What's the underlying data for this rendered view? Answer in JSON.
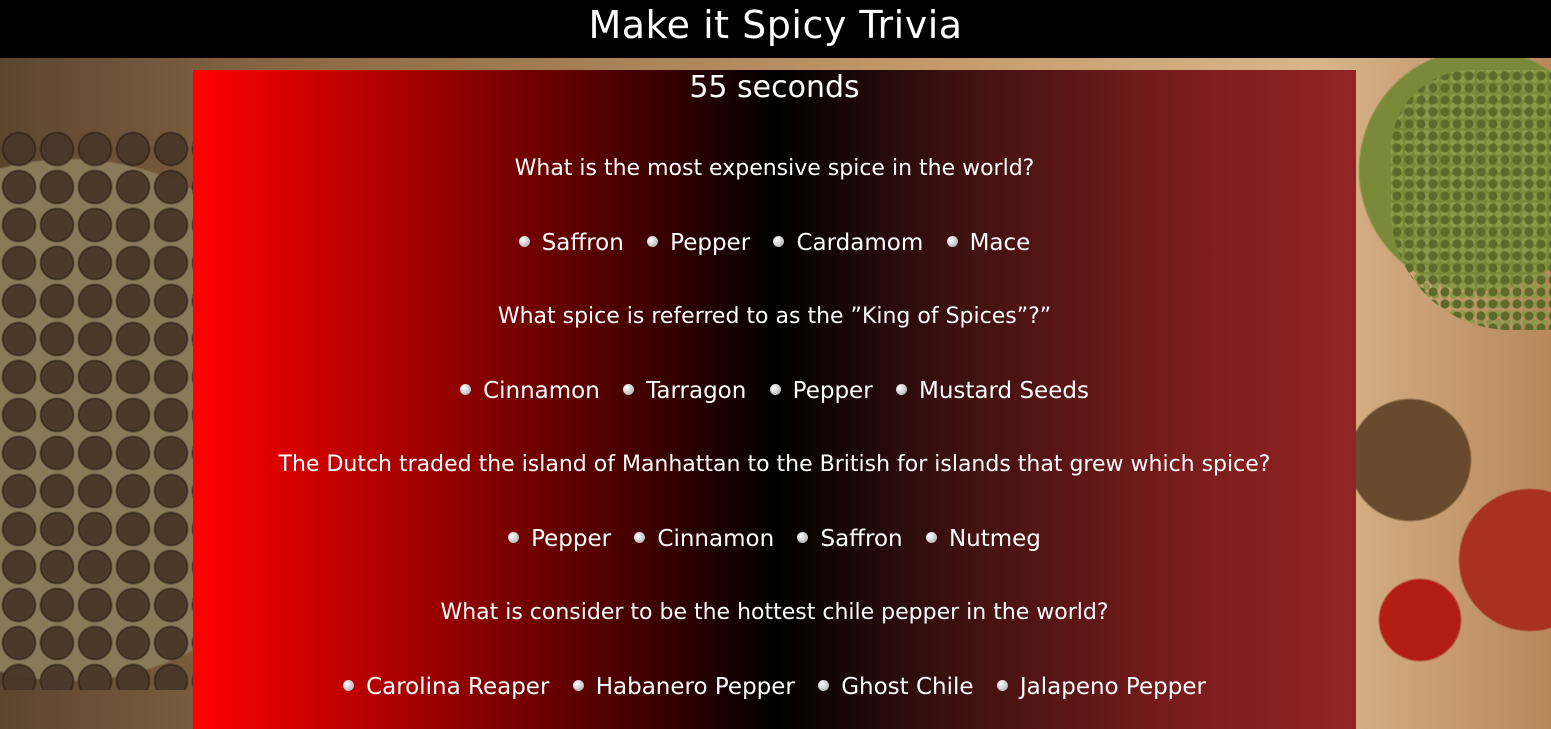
{
  "header": {
    "title": "Make it Spicy Trivia"
  },
  "timer": {
    "text": "55 seconds"
  },
  "questions": [
    {
      "text": "What is the most expensive spice in the world?",
      "options": [
        "Saffron",
        "Pepper",
        "Cardamom",
        "Mace"
      ]
    },
    {
      "text": "What spice is referred to as the ”King of Spices”?”",
      "options": [
        "Cinnamon",
        "Tarragon",
        "Pepper",
        "Mustard Seeds"
      ]
    },
    {
      "text": "The Dutch traded the island of Manhattan to the British for islands that grew which spice?",
      "options": [
        "Pepper",
        "Cinnamon",
        "Saffron",
        "Nutmeg"
      ]
    },
    {
      "text": "What is consider to be the hottest chile pepper in the world?",
      "options": [
        "Carolina Reaper",
        "Habanero Pepper",
        "Ghost Chile",
        "Jalapeno Pepper"
      ]
    }
  ]
}
